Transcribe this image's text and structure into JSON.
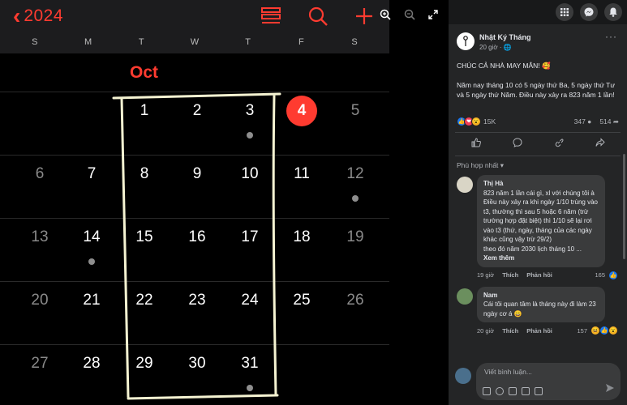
{
  "calendar": {
    "year_label": "2024",
    "month_label": "Oct",
    "weekdays": [
      "S",
      "M",
      "T",
      "W",
      "T",
      "F",
      "S"
    ],
    "weeks": [
      [
        "",
        "",
        "1",
        "2",
        "3",
        "4",
        "5"
      ],
      [
        "6",
        "7",
        "8",
        "9",
        "10",
        "11",
        "12"
      ],
      [
        "13",
        "14",
        "15",
        "16",
        "17",
        "18",
        "19"
      ],
      [
        "20",
        "21",
        "22",
        "23",
        "24",
        "25",
        "26"
      ],
      [
        "27",
        "28",
        "29",
        "30",
        "31",
        "",
        ""
      ]
    ],
    "today": "4",
    "accent_color": "#ff3b30"
  },
  "post": {
    "author_name": "Nhật Ký Tháng",
    "time": "20 giờ",
    "line1": "CHÚC CẢ NHÀ MAY MẮN! 🥰",
    "line2": "Năm nay tháng 10 có 5 ngày thứ Ba, 5 ngày thứ Tư và 5 ngày thứ Năm. Điều này xảy ra 823 năm 1 lần!",
    "reaction_count": "15K",
    "comment_count": "347",
    "share_count": "514"
  },
  "sort_label": "Phù hợp nhất",
  "comments": [
    {
      "name": "Thị Hà",
      "text1": "823 năm 1 lần cái gì, xl với chúng tôi à",
      "text2": "Điều này xảy ra khi ngày 1/10 trùng vào t3, thường thì sau 5 hoặc 6 năm (trừ trường hợp đặt biệt) thì 1/10 sẽ lại rơi vào t3 (thứ, ngày, tháng của các ngày khác cũng vậy trừ 29/2)",
      "text3": "theo đó năm 2030 lịch tháng 10 ...",
      "see_more": "Xem thêm",
      "time": "19 giờ",
      "like": "Thích",
      "reply": "Phản hồi",
      "likes": "165"
    },
    {
      "name": "Nam",
      "text1": "Cái tôi quan tâm là tháng này đi làm 23 ngày cơ á 😀",
      "time": "20 giờ",
      "like": "Thích",
      "reply": "Phản hồi",
      "likes": "157"
    }
  ],
  "composer_placeholder": "Viết bình luận..."
}
